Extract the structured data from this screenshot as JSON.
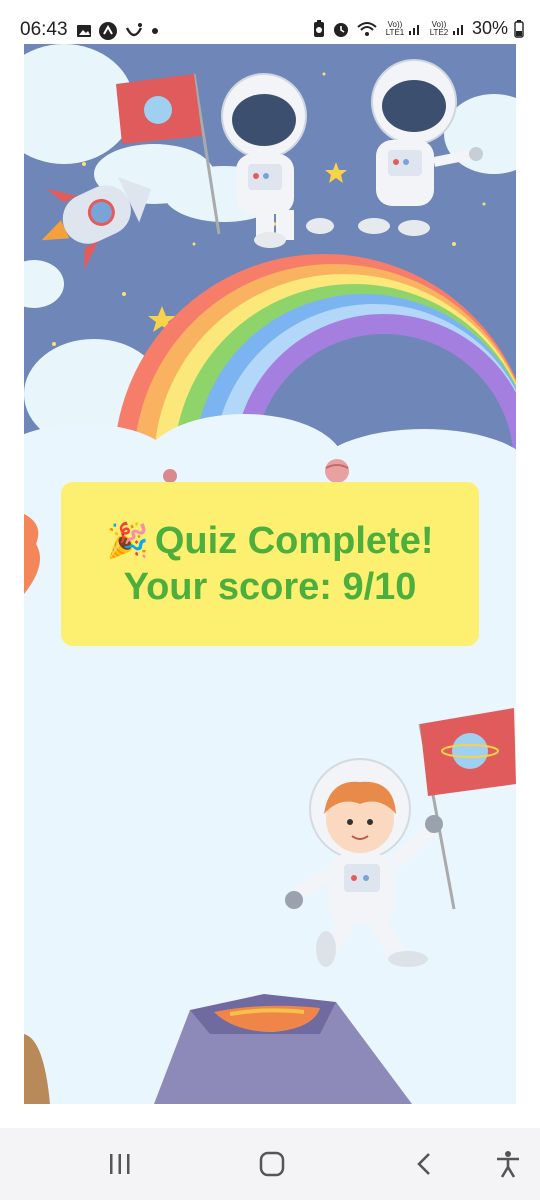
{
  "status_bar": {
    "time": "06:43",
    "sim1_label": "Vo)) LTE1",
    "sim2_label": "Vo)) LTE2",
    "battery_percent": "30%",
    "icons": [
      "gallery-icon",
      "notification-icon",
      "signal-icon",
      "dot-icon",
      "battery-saver-icon",
      "alarm-icon",
      "wifi-icon",
      "battery-icon"
    ]
  },
  "result": {
    "emoji": "🎉",
    "title": "Quiz Complete!",
    "score_text": "Your score: 9/10"
  },
  "nav_bar": {
    "icons": [
      "recent-apps-icon",
      "home-icon",
      "back-icon",
      "accessibility-icon"
    ]
  },
  "colors": {
    "card_background": "#fdef6f",
    "card_text": "#4cae3c",
    "sky": "#6f86b8",
    "nav_background": "#f4f4f6"
  }
}
